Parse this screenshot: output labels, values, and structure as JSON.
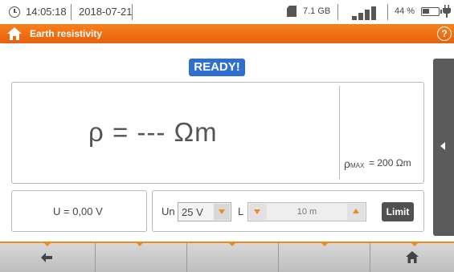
{
  "status_bar": {
    "time": "14:05:18",
    "date": "2018-07-21",
    "storage": "7.1 GB",
    "battery_percent": "44 %",
    "battery_level": 0.44
  },
  "title_bar": {
    "title": "Earth resistivity",
    "help": "?"
  },
  "badge": {
    "status": "READY!"
  },
  "result": {
    "value": "ρ = --- Ωm",
    "rho_symbol": "ρ",
    "max_subscript": "MAX",
    "max_value": "= 200 Ωm"
  },
  "voltage": {
    "text": "U = 0,00 V"
  },
  "settings": {
    "un_label": "Un",
    "un_value": "25 V",
    "l_label": "L",
    "l_value": "10 m",
    "limit_label": "Limit"
  },
  "icons": {
    "clock": "clock-icon",
    "sd_card": "sd-card-icon",
    "signal": "signal-icon",
    "battery": "battery-icon",
    "plug": "plug-icon",
    "home": "home-icon",
    "help": "help-icon",
    "back": "back-arrow-icon",
    "sidebar": "chevron-left-icon"
  },
  "colors": {
    "accent": "#f08a1d",
    "title_bar": "#f07a1a",
    "ready_badge": "#2e6fd1",
    "limit_button": "#505050"
  }
}
